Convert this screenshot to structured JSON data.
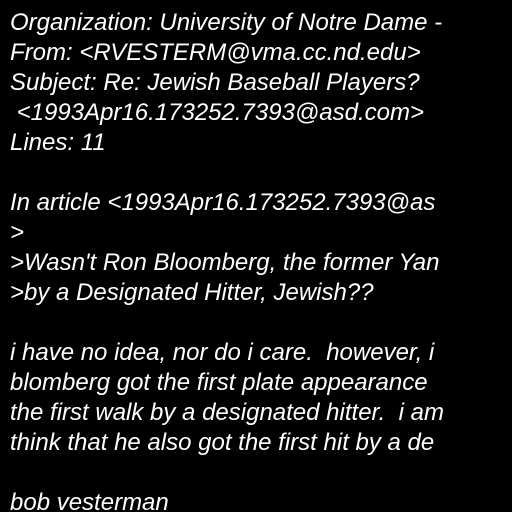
{
  "background_color": "#000000",
  "text_color": "#ffffff",
  "document": {
    "lines": [
      "Organization: University of Notre Dame -",
      "From: <RVESTERM@vma.cc.nd.edu>",
      "Subject: Re: Jewish Baseball Players?",
      " <1993Apr16.173252.7393@asd.com>",
      "Lines: 11",
      "",
      "In article <1993Apr16.173252.7393@as",
      ">",
      ">Wasn't Ron Bloomberg, the former Yan",
      ">by a Designated Hitter, Jewish??",
      "",
      "i have no idea, nor do i care.  however, i",
      "blomberg got the first plate appearance",
      "the first walk by a designated hitter.  i am",
      "think that he also got the first hit by a de",
      "",
      "bob vesterman"
    ]
  }
}
